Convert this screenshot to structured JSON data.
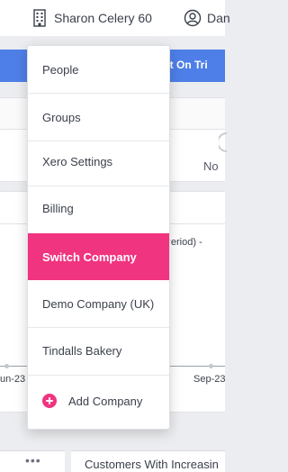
{
  "topbar": {
    "company_icon": "building-icon",
    "company_name": "Sharon Celery 60",
    "user_icon": "user-circle-icon",
    "user_name": "Dan"
  },
  "banner": {
    "text": "eft On Tri"
  },
  "stat_panel": {
    "text": "No"
  },
  "chart": {
    "legend_fragment": "s Period)  -",
    "x_ticks": [
      "un-23",
      "Sep-23"
    ]
  },
  "footer": {
    "more_label": "•••",
    "card_title": "Customers With Increasin"
  },
  "dropdown": {
    "items": [
      {
        "label": "People",
        "active": false
      },
      {
        "label": "Groups",
        "active": false
      },
      {
        "label": "Xero Settings",
        "active": false
      },
      {
        "label": "Billing",
        "active": false
      },
      {
        "label": "Switch Company",
        "active": true
      },
      {
        "label": "Demo Company (UK)",
        "active": false
      },
      {
        "label": "Tindalls Bakery",
        "active": false
      }
    ],
    "add_company": {
      "label": "Add Company",
      "icon": "plus-circle-icon"
    }
  },
  "colors": {
    "accent": "#f0347f",
    "banner": "#4e7fe8",
    "text": "#3a3f4b"
  }
}
